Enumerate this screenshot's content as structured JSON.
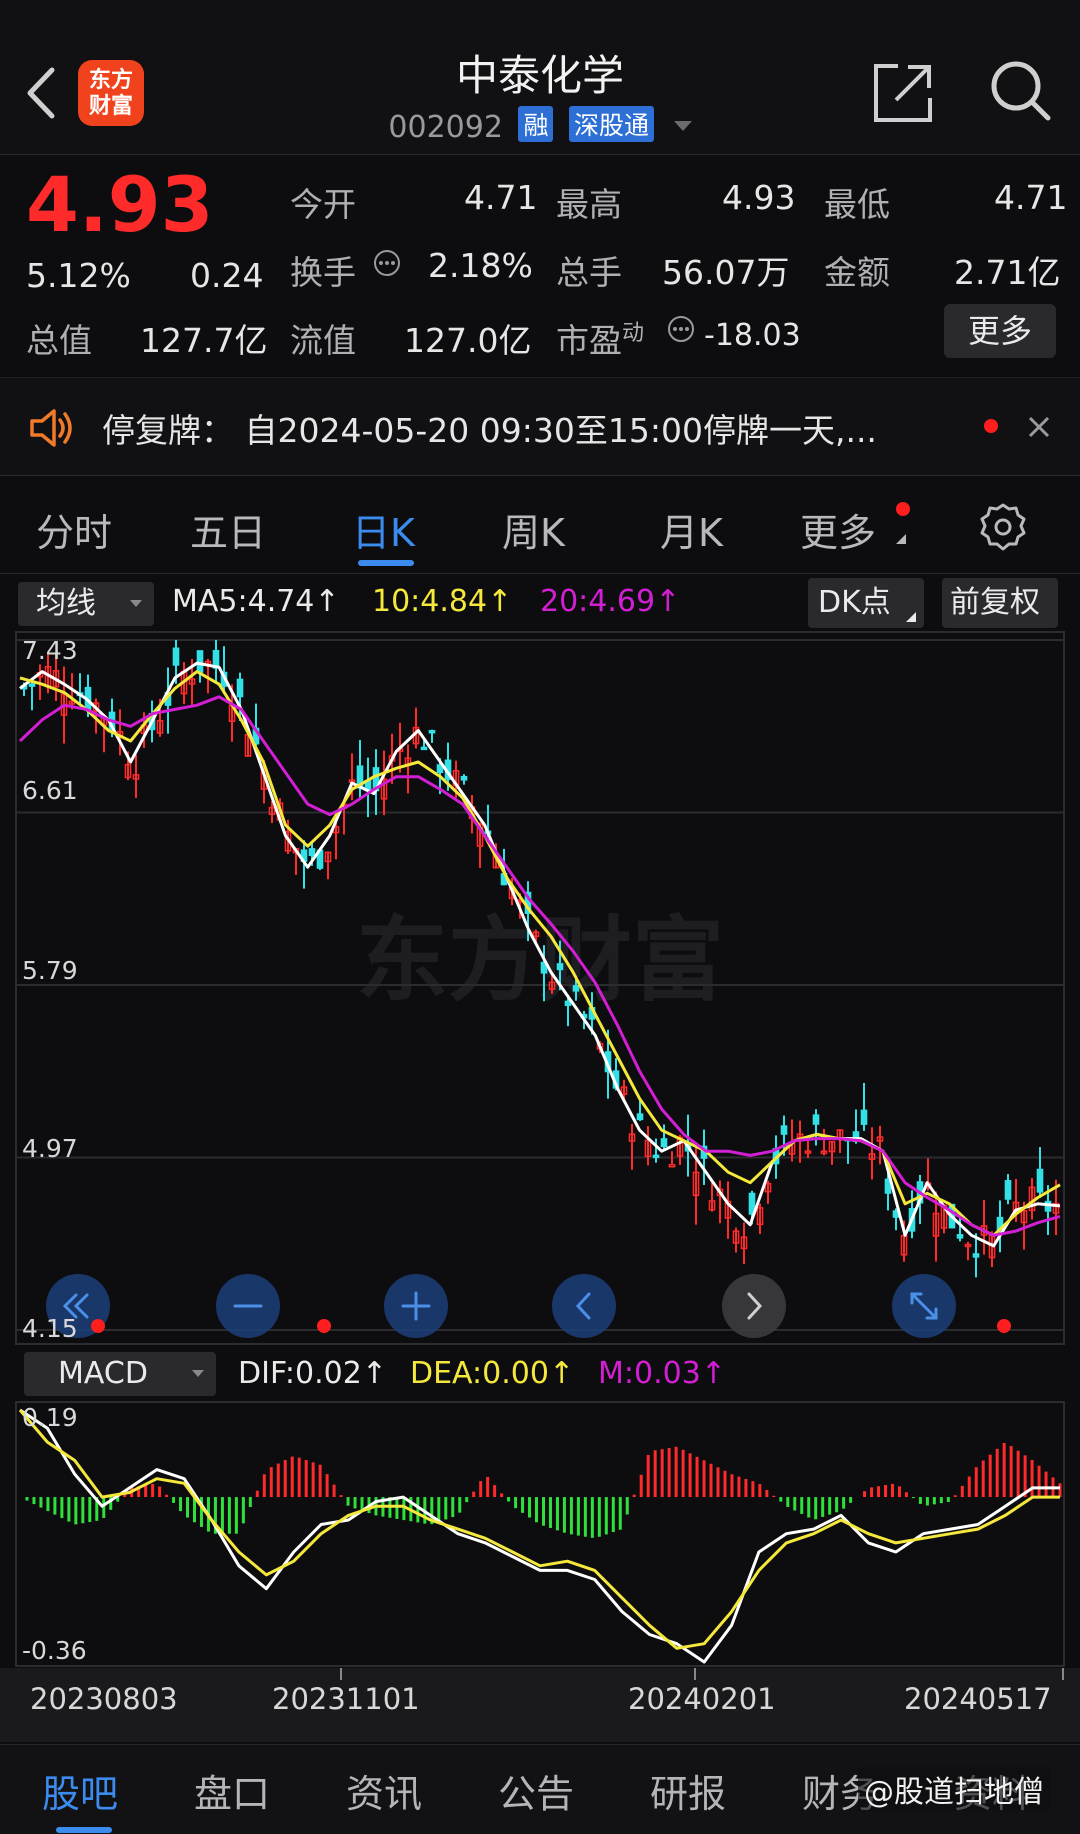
{
  "header": {
    "back_icon": "chevron-left-icon",
    "logo": "东方\n财富",
    "title": "中泰化学",
    "code": "002092",
    "tags": [
      "融",
      "深股通"
    ],
    "share_icon": "share-icon",
    "search_icon": "search-icon"
  },
  "quote": {
    "price": "4.93",
    "change_pct": "5.12%",
    "change": "0.24",
    "rows": [
      [
        {
          "label": "今开",
          "value": "4.71",
          "red": true
        },
        {
          "label": "最高",
          "value": "4.93",
          "red": true
        },
        {
          "label": "最低",
          "value": "4.71",
          "red": true
        }
      ],
      [
        {
          "label": "换手",
          "value": "2.18%"
        },
        {
          "label": "总手",
          "value": "56.07万"
        },
        {
          "label": "金额",
          "value": "2.71亿"
        }
      ],
      [
        {
          "label": "总值",
          "value": "127.7亿"
        },
        {
          "label": "流值",
          "value": "127.0亿"
        },
        {
          "label": "市盈",
          "sup": "动",
          "value": "-18.03"
        }
      ]
    ],
    "more": "更多"
  },
  "notice": {
    "text": "停复牌：  自2024-05-20 09:30至15:00停牌一天,..."
  },
  "tabs": [
    "分时",
    "五日",
    "日K",
    "周K",
    "月K",
    "更多"
  ],
  "ma_bar": {
    "select": "均线",
    "ma5": "MA5:4.74↑",
    "ma10": "10:4.84↑",
    "ma20": "20:4.69↑",
    "dk": "DK点",
    "adjust": "前复权"
  },
  "kline_axis": [
    "7.43",
    "6.61",
    "5.79",
    "4.97",
    "4.15"
  ],
  "macd_bar": {
    "select": "MACD",
    "dif": "DIF:0.02↑",
    "dea": "DEA:0.00↑",
    "m": "M:0.03↑"
  },
  "macd_axis": [
    "0.19",
    "-0.36"
  ],
  "dates": [
    "20230803",
    "20231101",
    "20240201",
    "20240517"
  ],
  "watermark": "东方财富",
  "bottom_nav": [
    "股吧",
    "盘口",
    "资讯",
    "公告",
    "研报",
    "财务",
    "资料"
  ],
  "weibo_mark": "@股道扫地僧",
  "colors": {
    "up": "#ff2a2a",
    "down": "#33e0e6",
    "ma5": "#ffffff",
    "ma10": "#f5e83c",
    "ma20": "#d21fd4",
    "accent": "#3c8cf0",
    "macd_up": "#ff2a2a",
    "macd_down": "#2fe03a"
  },
  "chart_data": [
    {
      "type": "candlestick",
      "title": "",
      "ylim": [
        4.15,
        7.43
      ],
      "y_ticks": [
        7.43,
        6.61,
        5.79,
        4.97,
        4.15
      ],
      "x_ticks": [
        "20230803",
        "20231101",
        "20240201",
        "20240517"
      ],
      "series": [
        {
          "name": "MA5",
          "values": [
            7.2,
            7.28,
            7.22,
            7.15,
            7.05,
            6.85,
            7.05,
            7.25,
            7.32,
            7.3,
            7.1,
            6.8,
            6.5,
            6.35,
            6.5,
            6.75,
            6.7,
            6.9,
            7.0,
            6.85,
            6.7,
            6.55,
            6.3,
            6.05,
            5.85,
            5.7,
            5.55,
            5.3,
            5.1,
            5.0,
            5.05,
            4.9,
            4.75,
            4.65,
            4.95,
            5.05,
            5.08,
            5.06,
            5.06,
            5.0,
            4.6,
            4.85,
            4.7,
            4.6,
            4.55,
            4.72,
            4.75,
            4.74
          ]
        },
        {
          "name": "10",
          "values": [
            7.25,
            7.22,
            7.18,
            7.1,
            7.0,
            6.95,
            7.08,
            7.2,
            7.28,
            7.22,
            7.05,
            6.85,
            6.55,
            6.45,
            6.55,
            6.72,
            6.78,
            6.82,
            6.85,
            6.78,
            6.68,
            6.5,
            6.3,
            6.15,
            6.02,
            5.85,
            5.65,
            5.45,
            5.25,
            5.1,
            5.05,
            5.0,
            4.9,
            4.85,
            4.95,
            5.05,
            5.08,
            5.06,
            5.05,
            5.0,
            4.75,
            4.8,
            4.75,
            4.65,
            4.6,
            4.7,
            4.78,
            4.84
          ]
        },
        {
          "name": "20",
          "values": [
            6.95,
            7.05,
            7.12,
            7.1,
            7.05,
            7.02,
            7.08,
            7.1,
            7.12,
            7.16,
            7.1,
            6.95,
            6.8,
            6.65,
            6.6,
            6.65,
            6.72,
            6.78,
            6.78,
            6.72,
            6.65,
            6.5,
            6.35,
            6.2,
            6.08,
            5.95,
            5.8,
            5.6,
            5.38,
            5.2,
            5.08,
            5.0,
            5.0,
            4.98,
            5.0,
            5.05,
            5.06,
            5.06,
            5.05,
            5.0,
            4.85,
            4.78,
            4.72,
            4.65,
            4.6,
            4.62,
            4.66,
            4.69
          ]
        }
      ]
    },
    {
      "type": "bar",
      "title": "",
      "ylim": [
        -0.36,
        0.19
      ],
      "series": [
        {
          "name": "DIF",
          "values": [
            0.19,
            0.15,
            0.05,
            -0.02,
            0.02,
            0.06,
            0.04,
            -0.05,
            -0.15,
            -0.2,
            -0.12,
            -0.06,
            -0.05,
            -0.01,
            0.0,
            -0.04,
            -0.08,
            -0.1,
            -0.13,
            -0.16,
            -0.16,
            -0.18,
            -0.25,
            -0.3,
            -0.32,
            -0.36,
            -0.28,
            -0.12,
            -0.08,
            -0.07,
            -0.04,
            -0.1,
            -0.12,
            -0.08,
            -0.07,
            -0.06,
            -0.02,
            0.02,
            0.02
          ]
        },
        {
          "name": "DEA",
          "values": [
            0.19,
            0.12,
            0.08,
            0.0,
            0.01,
            0.04,
            0.03,
            -0.05,
            -0.12,
            -0.17,
            -0.14,
            -0.08,
            -0.04,
            -0.02,
            -0.02,
            -0.05,
            -0.07,
            -0.09,
            -0.12,
            -0.15,
            -0.14,
            -0.16,
            -0.22,
            -0.28,
            -0.33,
            -0.32,
            -0.25,
            -0.16,
            -0.1,
            -0.08,
            -0.05,
            -0.08,
            -0.1,
            -0.09,
            -0.08,
            -0.07,
            -0.04,
            0.0,
            0.0
          ]
        },
        {
          "name": "M",
          "values": [
            0.0,
            -0.03,
            -0.06,
            -0.05,
            0.02,
            0.03,
            -0.04,
            -0.08,
            -0.08,
            0.06,
            0.09,
            0.07,
            -0.02,
            -0.04,
            -0.05,
            -0.06,
            -0.04,
            0.05,
            -0.02,
            -0.06,
            -0.08,
            -0.09,
            -0.07,
            0.1,
            0.11,
            0.08,
            0.05,
            0.03,
            -0.02,
            -0.05,
            -0.03,
            0.02,
            0.03,
            -0.02,
            -0.01,
            0.07,
            0.12,
            0.08,
            0.03
          ]
        }
      ]
    }
  ]
}
